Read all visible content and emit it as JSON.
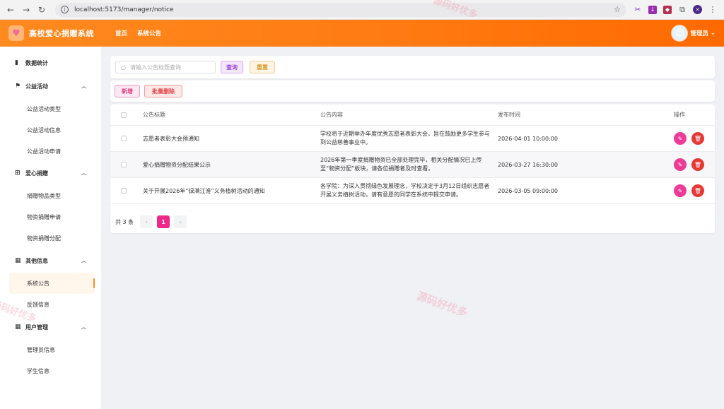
{
  "browser": {
    "url": "localhost:5173/manager/notice"
  },
  "header": {
    "app_title": "高校爱心捐赠系统",
    "nav": [
      "首页",
      "系统公告"
    ],
    "user_label": "管理员"
  },
  "sidebar": {
    "groups": [
      {
        "label": "数据统计",
        "icon": "bar-chart-icon"
      },
      {
        "label": "公益活动",
        "icon": "flag-icon",
        "items": [
          "公益活动类型",
          "公益活动信息",
          "公益活动申请"
        ]
      },
      {
        "label": "爱心捐赠",
        "icon": "gift-icon",
        "items": [
          "捐赠物品类型",
          "物资捐赠申请",
          "物资捐赠分配"
        ]
      },
      {
        "label": "其他信息",
        "icon": "grid-icon",
        "items": [
          "系统公告",
          "反馈信息"
        ]
      },
      {
        "label": "用户管理",
        "icon": "grid-icon",
        "items": [
          "管理员信息",
          "学生信息"
        ]
      }
    ],
    "active_item": "系统公告"
  },
  "search": {
    "placeholder": "请输入公告标题查询",
    "query_label": "查询",
    "reset_label": "重置"
  },
  "actions": {
    "add_label": "新增",
    "batch_delete_label": "批量删除"
  },
  "table": {
    "columns": [
      "公告标题",
      "公告内容",
      "发布时间",
      "操作"
    ],
    "rows": [
      {
        "title": "志愿者表彰大会预通知",
        "content": "学校将于近期举办年度优秀志愿者表彰大会，旨在鼓励更多学生参与到公益慈善事业中。",
        "time": "2026-04-01 10:00:00"
      },
      {
        "title": "爱心捐赠物资分配结果公示",
        "content": "2026年第一季度捐赠物资已全部处理完毕，相关分配情况已上传至“物资分配”板块，请各位捐赠者及时查看。",
        "time": "2026-03-27 16:30:00"
      },
      {
        "title": "关于开展2026年“绿满江淮”义务植树活动的通知",
        "content": "各学院：为深入贯彻绿色发展理念，学校决定于3月12日组织志愿者开展义务植树活动，请有意愿的同学在系统中提交申请。",
        "time": "2026-03-05 09:00:00"
      }
    ]
  },
  "pagination": {
    "total_text": "共 3 条",
    "current_page": "1",
    "prev": "‹",
    "next": "›"
  },
  "watermark": "源码好优多",
  "colors": {
    "header_start": "#ff8a1f",
    "header_end": "#ff6a00",
    "accent_pink": "#f0288a",
    "danger": "#e53935"
  }
}
